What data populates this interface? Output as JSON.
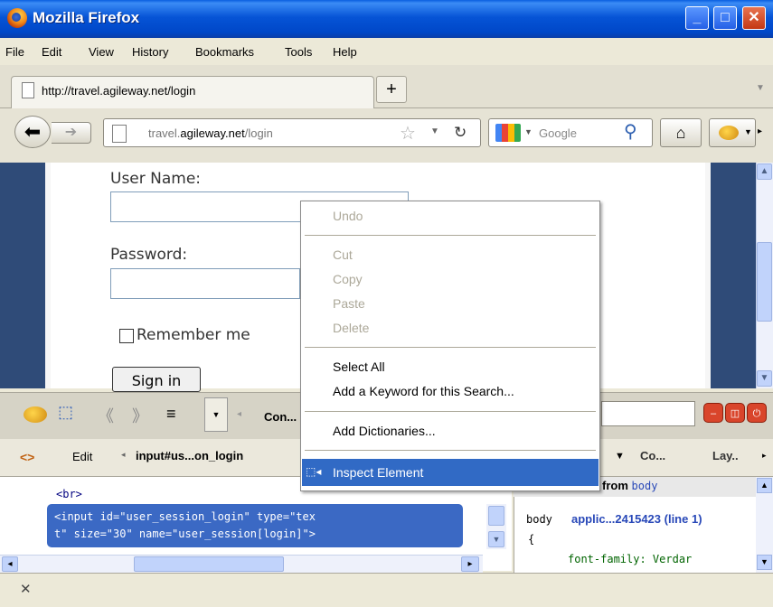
{
  "window": {
    "title": "Mozilla Firefox"
  },
  "menu": [
    "File",
    "Edit",
    "View",
    "History",
    "Bookmarks",
    "Tools",
    "Help"
  ],
  "tab": {
    "title": "http://travel.agileway.net/login",
    "new_tab": "+"
  },
  "navbar": {
    "url_prefix": "travel.",
    "url_domain": "agileway.net",
    "url_path": "/login",
    "search_placeholder": "Google"
  },
  "page": {
    "username_label": "User Name:",
    "password_label": "Password:",
    "remember_label": "Remember me",
    "signin_label": "Sign in"
  },
  "firebug": {
    "console_tab": "Con...",
    "edit": "Edit",
    "breadcrumb": "input#us...on_login",
    "side_tab_1": "Co...",
    "side_tab_2": "Lay..",
    "html_br": "<br>",
    "html_line1": "<input id=\"user_session_login\" type=\"tex",
    "html_line2": "t\" size=\"30\" name=\"user_session[login]\">",
    "inherited_prefix": "from",
    "inherited_el": "body",
    "style_selector": "body",
    "style_source": "applic...2415423 (line 1)",
    "style_brace": "{",
    "style_prop": "font-family: Verdar"
  },
  "context_menu": {
    "undo": "Undo",
    "cut": "Cut",
    "copy": "Copy",
    "paste": "Paste",
    "delete": "Delete",
    "select_all": "Select All",
    "add_keyword": "Add a Keyword for this Search...",
    "add_dictionaries": "Add Dictionaries...",
    "inspect": "Inspect Element"
  },
  "colors": {
    "titlebar": "#0654d6",
    "highlight": "#316ac5",
    "content_side": "#2f4b78"
  }
}
